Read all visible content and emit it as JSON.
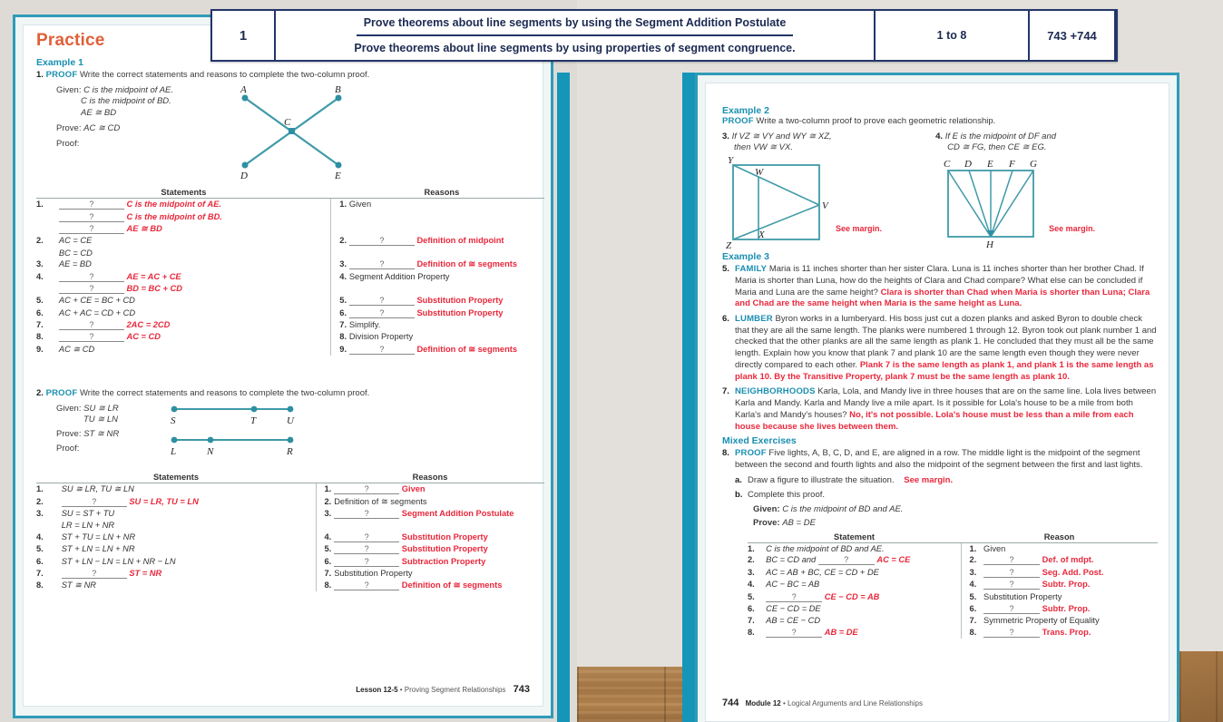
{
  "header_table": {
    "number": "1",
    "objectives": [
      "Prove theorems about line segments by using the Segment Addition Postulate",
      "Prove theorems about line segments by using properties of segment congruence."
    ],
    "range": "1 to 8",
    "pages": "743 +744"
  },
  "left_page": {
    "title": "Practice",
    "example1_label": "Example 1",
    "problem1": {
      "number": "1.",
      "tag": "PROOF",
      "text": "Write the correct statements and reasons to complete the two-column proof.",
      "given_label": "Given:",
      "given": [
        "C is the midpoint of AE.",
        "C is the midpoint of BD.",
        "AE ≅ BD"
      ],
      "prove_label": "Prove:",
      "prove": "AC ≅ CD",
      "proof_label": "Proof:",
      "figure_labels": [
        "A",
        "B",
        "C",
        "D",
        "E"
      ],
      "statements_header": "Statements",
      "reasons_header": "Reasons",
      "statements": [
        {
          "n": "1.",
          "blank": "?",
          "ans": "C is the midpoint of AE.",
          "red": true
        },
        {
          "n": "",
          "blank": "?",
          "ans": "C is the midpoint of BD.",
          "red": true
        },
        {
          "n": "",
          "blank": "?",
          "ans": "AE ≅ BD",
          "red": true
        },
        {
          "n": "2.",
          "blank": "",
          "ans": "AC = CE",
          "red": false
        },
        {
          "n": "",
          "blank": "",
          "ans": "BC = CD",
          "red": false
        },
        {
          "n": "3.",
          "blank": "",
          "ans": "AE = BD",
          "red": false
        },
        {
          "n": "4.",
          "blank": "?",
          "ans": "AE = AC + CE",
          "red": true
        },
        {
          "n": "",
          "blank": "?",
          "ans": "BD = BC + CD",
          "red": true
        },
        {
          "n": "5.",
          "blank": "",
          "ans": "AC + CE = BC + CD",
          "red": false
        },
        {
          "n": "6.",
          "blank": "",
          "ans": "AC + AC = CD + CD",
          "red": false
        },
        {
          "n": "7.",
          "blank": "?",
          "ans": "2AC = 2CD",
          "red": true
        },
        {
          "n": "8.",
          "blank": "?",
          "ans": "AC = CD",
          "red": true
        },
        {
          "n": "9.",
          "blank": "",
          "ans": "AC ≅ CD",
          "red": false
        }
      ],
      "reasons": [
        {
          "n": "1.",
          "blank": "",
          "ans": "Given",
          "red": false
        },
        {
          "n": "",
          "blank": "",
          "ans": "",
          "red": false
        },
        {
          "n": "",
          "blank": "",
          "ans": "",
          "red": false
        },
        {
          "n": "2.",
          "blank": "?",
          "ans": "Definition of midpoint",
          "red": true
        },
        {
          "n": "",
          "blank": "",
          "ans": "",
          "red": false
        },
        {
          "n": "3.",
          "blank": "?",
          "ans": "Definition of ≅ segments",
          "red": true
        },
        {
          "n": "4.",
          "blank": "",
          "ans": "Segment Addition Property",
          "red": false
        },
        {
          "n": "",
          "blank": "",
          "ans": "",
          "red": false
        },
        {
          "n": "5.",
          "blank": "?",
          "ans": "Substitution Property",
          "red": true
        },
        {
          "n": "6.",
          "blank": "?",
          "ans": "Substitution Property",
          "red": true
        },
        {
          "n": "7.",
          "blank": "",
          "ans": "Simplify.",
          "red": false
        },
        {
          "n": "8.",
          "blank": "",
          "ans": "Division Property",
          "red": false
        },
        {
          "n": "9.",
          "blank": "?",
          "ans": "Definition of ≅ segments",
          "red": true
        }
      ]
    },
    "problem2": {
      "number": "2.",
      "tag": "PROOF",
      "text": "Write the correct statements and reasons to complete the two-column proof.",
      "given_label": "Given:",
      "given": [
        "SU ≅ LR",
        "TU ≅ LN"
      ],
      "prove_label": "Prove:",
      "prove": "ST ≅ NR",
      "proof_label": "Proof:",
      "figure_labels_top": [
        "S",
        "T",
        "U"
      ],
      "figure_labels_bottom": [
        "L",
        "N",
        "R"
      ],
      "statements_header": "Statements",
      "reasons_header": "Reasons",
      "statements": [
        {
          "n": "1.",
          "blank": "",
          "ans": "SU ≅ LR, TU ≅ LN",
          "red": false
        },
        {
          "n": "2.",
          "blank": "?",
          "ans": "SU = LR, TU = LN",
          "red": true
        },
        {
          "n": "3.",
          "blank": "",
          "ans": "SU = ST + TU",
          "red": false
        },
        {
          "n": "",
          "blank": "",
          "ans": "LR = LN + NR",
          "red": false
        },
        {
          "n": "4.",
          "blank": "",
          "ans": "ST + TU = LN + NR",
          "red": false
        },
        {
          "n": "5.",
          "blank": "",
          "ans": "ST + LN = LN + NR",
          "red": false
        },
        {
          "n": "6.",
          "blank": "",
          "ans": "ST + LN − LN = LN + NR − LN",
          "red": false
        },
        {
          "n": "7.",
          "blank": "?",
          "ans": "ST = NR",
          "red": true
        },
        {
          "n": "8.",
          "blank": "",
          "ans": "ST ≅ NR",
          "red": false
        }
      ],
      "reasons": [
        {
          "n": "1.",
          "blank": "?",
          "ans": "Given",
          "red": true
        },
        {
          "n": "2.",
          "blank": "",
          "ans": "Definition of ≅ segments",
          "red": false
        },
        {
          "n": "3.",
          "blank": "?",
          "ans": "Segment Addition Postulate",
          "red": true
        },
        {
          "n": "",
          "blank": "",
          "ans": "",
          "red": false
        },
        {
          "n": "4.",
          "blank": "?",
          "ans": "Substitution Property",
          "red": true
        },
        {
          "n": "5.",
          "blank": "?",
          "ans": "Substitution Property",
          "red": true
        },
        {
          "n": "6.",
          "blank": "?",
          "ans": "Subtraction Property",
          "red": true
        },
        {
          "n": "7.",
          "blank": "",
          "ans": "Substitution Property",
          "red": false
        },
        {
          "n": "8.",
          "blank": "?",
          "ans": "Definition of ≅ segments",
          "red": true
        }
      ]
    },
    "footer": {
      "lesson": "Lesson 12-5",
      "dot": " • ",
      "title": "Proving Segment Relationships",
      "page": "743"
    }
  },
  "right_page": {
    "example2_label": "Example 2",
    "example2_tag": "PROOF",
    "example2_text": "Write a two-column proof to prove each geometric relationship.",
    "problem3": {
      "number": "3.",
      "line1": "If VZ ≅ VY and WY ≅ XZ,",
      "line2": "then VW ≅ VX.",
      "figure_labels": [
        "Y",
        "W",
        "V",
        "X",
        "Z"
      ],
      "answer": "See margin."
    },
    "problem4": {
      "number": "4.",
      "line1": "If E is the midpoint of DF and",
      "line2": "CD ≅ FG, then CE ≅ EG.",
      "figure_labels_top": [
        "C",
        "D",
        "E",
        "F",
        "G"
      ],
      "figure_label_bottom": "H",
      "answer": "See margin."
    },
    "example3_label": "Example 3",
    "problem5": {
      "number": "5.",
      "tag": "FAMILY",
      "text": "Maria is 11 inches shorter than her sister Clara. Luna is 11 inches shorter than her brother Chad. If Maria is shorter than Luna, how do the heights of Clara and Chad compare? What else can be concluded if Maria and Luna are the same height?",
      "answer": "Clara is shorter than Chad when Maria is shorter than Luna; Clara and Chad are the same height when Maria is the same height as Luna."
    },
    "problem6": {
      "number": "6.",
      "tag": "LUMBER",
      "text": "Byron works in a lumberyard. His boss just cut a dozen planks and asked Byron to double check that they are all the same length. The planks were numbered 1 through 12. Byron took out plank number 1 and checked that the other planks are all the same length as plank 1. He concluded that they must all be the same length. Explain how you know that plank 7 and plank 10 are the same length even though they were never directly compared to each other.",
      "answer": "Plank 7 is the same length as plank 1, and plank 1 is the same length as plank 10. By the Transitive Property, plank 7 must be the same length as plank 10."
    },
    "problem7": {
      "number": "7.",
      "tag": "NEIGHBORHOODS",
      "text": "Karla, Lola, and Mandy live in three houses that are on the same line. Lola lives between Karla and Mandy. Karla and Mandy live a mile apart. Is it possible for Lola's house to be a mile from both Karla's and Mandy's houses?",
      "answer": "No, it's not possible. Lola's house must be less than a mile from each house because she lives between them."
    },
    "mixed_exercises_label": "Mixed Exercises",
    "problem8": {
      "number": "8.",
      "tag": "PROOF",
      "text": "Five lights, A, B, C, D, and E, are aligned in a row. The middle light is the midpoint of the segment between the second and fourth lights and also the midpoint of the segment between the first and last lights.",
      "part_a_label": "a.",
      "part_a_text": "Draw a figure to illustrate the situation.",
      "part_a_answer": "See margin.",
      "part_b_label": "b.",
      "part_b_text": "Complete this proof.",
      "given_label": "Given:",
      "given": "C is the midpoint of BD and AE.",
      "prove_label": "Prove:",
      "prove": "AB = DE",
      "statement_header": "Statement",
      "reason_header": "Reason",
      "statements": [
        {
          "n": "1.",
          "pre": "C is the midpoint of BD and AE.",
          "blank": "",
          "ans": "",
          "red": false
        },
        {
          "n": "2.",
          "pre": "BC = CD and",
          "blank": "?",
          "ans": "AC = CE",
          "red": true
        },
        {
          "n": "3.",
          "pre": "AC = AB + BC, CE = CD + DE",
          "blank": "",
          "ans": "",
          "red": false
        },
        {
          "n": "4.",
          "pre": "AC − BC = AB",
          "blank": "",
          "ans": "",
          "red": false
        },
        {
          "n": "5.",
          "pre": "",
          "blank": "?",
          "ans": "CE − CD = AB",
          "red": true
        },
        {
          "n": "6.",
          "pre": "CE − CD = DE",
          "blank": "",
          "ans": "",
          "red": false
        },
        {
          "n": "7.",
          "pre": "AB = CE − CD",
          "blank": "",
          "ans": "",
          "red": false
        },
        {
          "n": "8.",
          "pre": "",
          "blank": "?",
          "ans": "AB = DE",
          "red": true
        }
      ],
      "reasons": [
        {
          "n": "1.",
          "blank": "",
          "ans": "Given",
          "red": false
        },
        {
          "n": "2.",
          "blank": "?",
          "ans": "Def. of mdpt.",
          "red": true
        },
        {
          "n": "3.",
          "blank": "?",
          "ans": "Seg. Add. Post.",
          "red": true
        },
        {
          "n": "4.",
          "blank": "?",
          "ans": "Subtr. Prop.",
          "red": true
        },
        {
          "n": "5.",
          "blank": "",
          "ans": "Substitution Property",
          "red": false
        },
        {
          "n": "6.",
          "blank": "?",
          "ans": "Subtr. Prop.",
          "red": true
        },
        {
          "n": "7.",
          "blank": "",
          "ans": "Symmetric Property of Equality",
          "red": false
        },
        {
          "n": "8.",
          "blank": "?",
          "ans": "Trans. Prop.",
          "red": true
        }
      ]
    },
    "footer": {
      "page": "744",
      "module": "Module 12",
      "dot": " • ",
      "title": "Logical Arguments and Line Relationships"
    }
  },
  "colors": {
    "teal": "#1596b8",
    "orange": "#e0603a",
    "red": "#e8283c",
    "navy": "#23356b",
    "figure": "#3f9aa8"
  }
}
